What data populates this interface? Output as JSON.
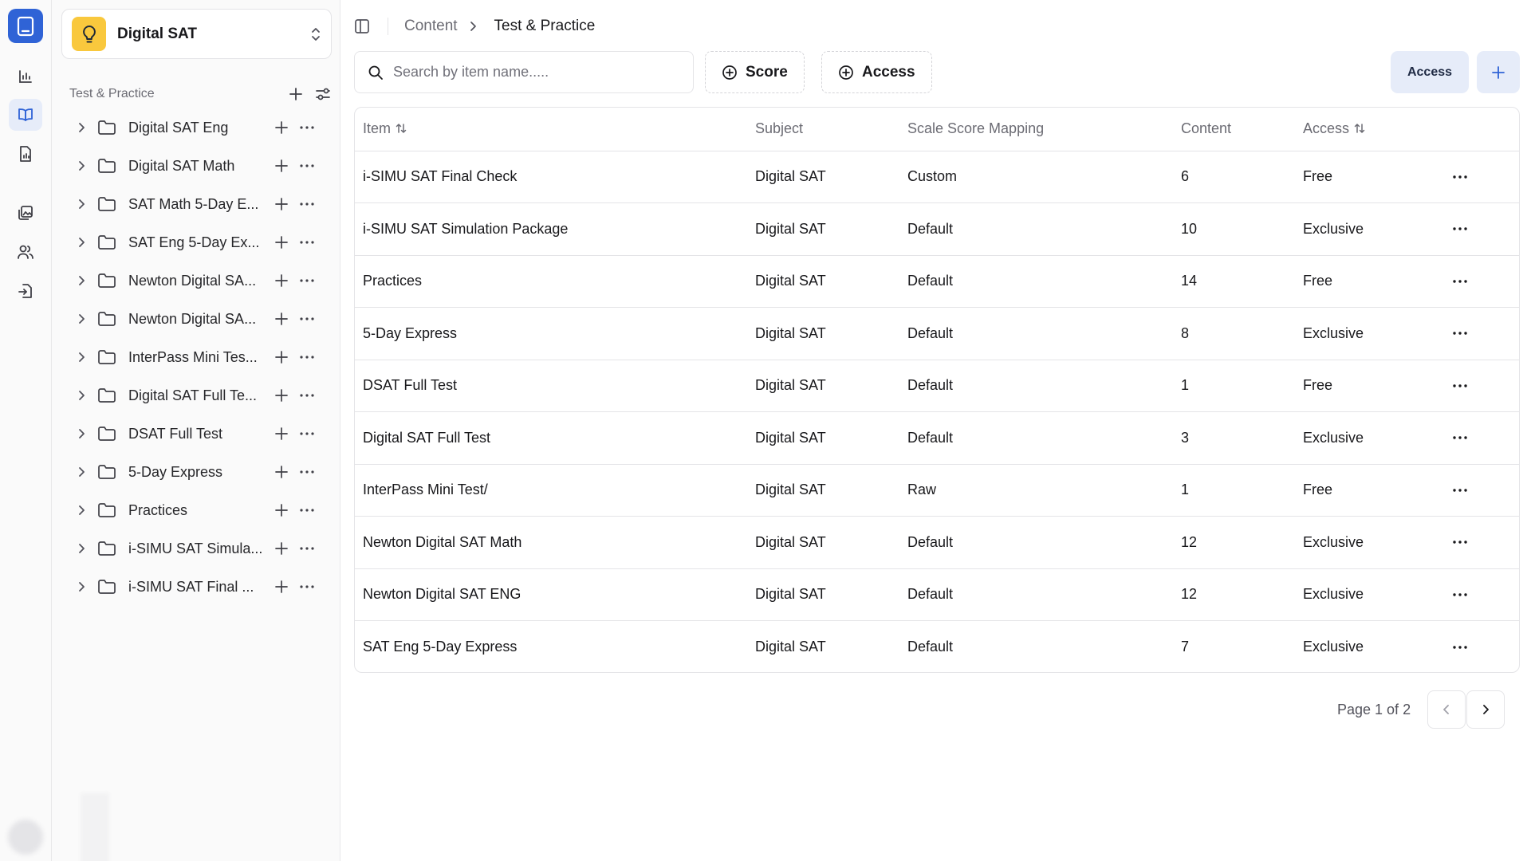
{
  "workspace": {
    "name": "Digital SAT"
  },
  "sidebar": {
    "section_title": "Test & Practice",
    "items": [
      {
        "label": "Digital SAT Eng"
      },
      {
        "label": "Digital SAT Math"
      },
      {
        "label": "SAT Math 5-Day E..."
      },
      {
        "label": "SAT Eng 5-Day Ex..."
      },
      {
        "label": "Newton Digital SA..."
      },
      {
        "label": "Newton Digital SA..."
      },
      {
        "label": "InterPass Mini Tes..."
      },
      {
        "label": "Digital SAT Full Te..."
      },
      {
        "label": "DSAT Full Test"
      },
      {
        "label": "5-Day Express"
      },
      {
        "label": "Practices"
      },
      {
        "label": "i-SIMU SAT Simula..."
      },
      {
        "label": "i-SIMU SAT Final ..."
      }
    ]
  },
  "breadcrumb": {
    "parent": "Content",
    "current": "Test & Practice"
  },
  "toolbar": {
    "search_placeholder": "Search by item name.....",
    "score_filter": "Score",
    "access_filter": "Access",
    "access_button": "Access"
  },
  "table": {
    "headers": {
      "item": "Item",
      "subject": "Subject",
      "mapping": "Scale Score Mapping",
      "content": "Content",
      "access": "Access"
    },
    "rows": [
      {
        "item": "i-SIMU SAT Final Check",
        "subject": "Digital SAT",
        "mapping": "Custom",
        "content": "6",
        "access": "Free"
      },
      {
        "item": "i-SIMU SAT Simulation Package",
        "subject": "Digital SAT",
        "mapping": "Default",
        "content": "10",
        "access": "Exclusive"
      },
      {
        "item": "Practices",
        "subject": "Digital SAT",
        "mapping": "Default",
        "content": "14",
        "access": "Free"
      },
      {
        "item": "5-Day Express",
        "subject": "Digital SAT",
        "mapping": "Default",
        "content": "8",
        "access": "Exclusive"
      },
      {
        "item": "DSAT Full Test",
        "subject": "Digital SAT",
        "mapping": "Default",
        "content": "1",
        "access": "Free"
      },
      {
        "item": "Digital SAT Full Test",
        "subject": "Digital SAT",
        "mapping": "Default",
        "content": "3",
        "access": "Exclusive"
      },
      {
        "item": "InterPass Mini Test/",
        "subject": "Digital SAT",
        "mapping": "Raw",
        "content": "1",
        "access": "Free"
      },
      {
        "item": "Newton Digital SAT Math",
        "subject": "Digital SAT",
        "mapping": "Default",
        "content": "12",
        "access": "Exclusive"
      },
      {
        "item": "Newton Digital SAT ENG",
        "subject": "Digital SAT",
        "mapping": "Default",
        "content": "12",
        "access": "Exclusive"
      },
      {
        "item": "SAT Eng 5-Day Express",
        "subject": "Digital SAT",
        "mapping": "Default",
        "content": "7",
        "access": "Exclusive"
      }
    ]
  },
  "pagination": {
    "label": "Page 1 of 2"
  },
  "colors": {
    "accent": "#2f63d6",
    "accent_soft": "#e6ecf9",
    "brand_yellow": "#f9c83d"
  }
}
